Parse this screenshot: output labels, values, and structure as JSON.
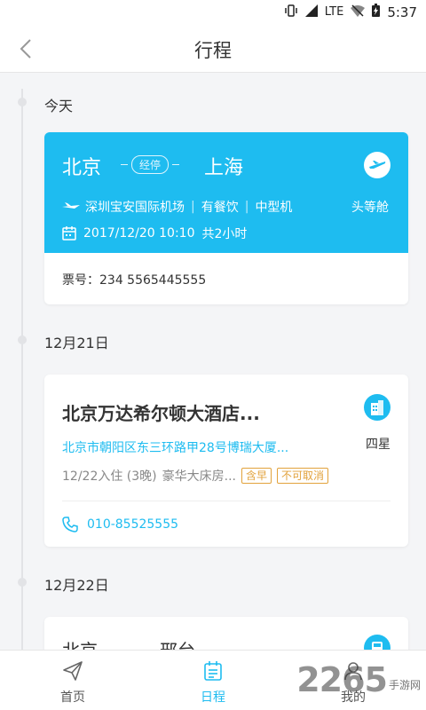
{
  "status_bar": {
    "network": "LTE",
    "time": "5:37"
  },
  "header": {
    "title": "行程"
  },
  "sections": [
    {
      "date": "今天"
    },
    {
      "date": "12月21日"
    },
    {
      "date": "12月22日"
    }
  ],
  "flight": {
    "from": "北京",
    "stopover": "经停",
    "to": "上海",
    "airport": "深圳宝安国际机场",
    "meal": "有餐饮",
    "aircraft": "中型机",
    "cabin": "头等舱",
    "datetime": "2017/12/20 10:10",
    "duration": "共2小时",
    "ticket": "票号：234 5565445555"
  },
  "hotel": {
    "name": "北京万达希尔顿大酒店...",
    "star": "四星",
    "address": "北京市朝阳区东三环路甲28号博瑞大厦...",
    "stay": "12/22入住 (3晚)",
    "room": "豪华大床房...",
    "tags": [
      "含早",
      "不可取消"
    ],
    "phone": "010-85525555"
  },
  "next_trip": {
    "from": "北京",
    "to": "邢台"
  },
  "tabs": [
    {
      "label": "首页",
      "icon": "paper-plane-icon"
    },
    {
      "label": "日程",
      "icon": "calendar-icon"
    },
    {
      "label": "我的",
      "icon": "person-icon"
    }
  ],
  "watermark": {
    "number": "2265",
    "text": "手游网"
  },
  "colors": {
    "accent": "#1ebcf0",
    "tag": "#e2a23b",
    "background": "#f4f5f7"
  }
}
